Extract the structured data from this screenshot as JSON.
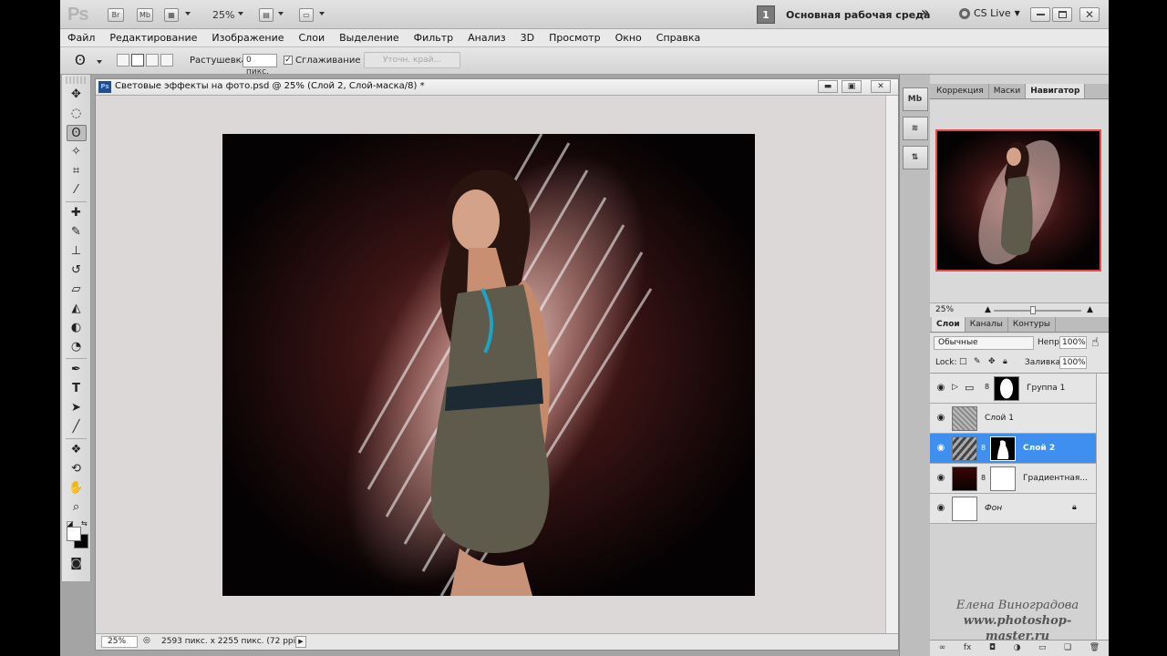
{
  "app": {
    "logo": "Ps",
    "zoom": "25%"
  },
  "appbar": {
    "buttons": [
      "Br",
      "Mb"
    ],
    "workspace_number": "1",
    "workspace_name": "Основная рабочая среда",
    "more_arrows": "»",
    "cs_live": "CS Live"
  },
  "menu": [
    "Файл",
    "Редактирование",
    "Изображение",
    "Слои",
    "Выделение",
    "Фильтр",
    "Анализ",
    "3D",
    "Просмотр",
    "Окно",
    "Справка"
  ],
  "options": {
    "feather_label": "Растушевка:",
    "feather_value": "0 пикс.",
    "antialias_label": "Сглаживание",
    "antialias_checked": "✓",
    "refine_edge": "Уточн. край..."
  },
  "document": {
    "ps_badge": "Ps",
    "title": "Световые эффекты на фото.psd @ 25% (Слой 2, Слой-маска/8) *",
    "status_zoom": "25%",
    "status_info": "2593 пикс. x 2255 пикс. (72 ppi)"
  },
  "panels": {
    "top_tabs": [
      "Коррекция",
      "Маски",
      "Навигатор"
    ],
    "navigator_zoom": "25%",
    "layer_tabs": [
      "Слои",
      "Каналы",
      "Контуры"
    ],
    "blend_mode": "Обычные",
    "opacity_label": "Непр:",
    "opacity_value": "100%",
    "lock_label": "Lock:",
    "fill_label": "Заливка:",
    "fill_value": "100%"
  },
  "layers": [
    {
      "name": "Группа 1"
    },
    {
      "name": "Слой 1"
    },
    {
      "name": "Слой 2"
    },
    {
      "name": "Градиентная..."
    },
    {
      "name": "Фон"
    }
  ],
  "dock": [
    "Mb",
    "≋",
    "⇅"
  ],
  "watermark": {
    "line1": "Елена Виноградова",
    "line2": "www.photoshop-master.ru"
  },
  "colors": {
    "accent_selected": "#3f8ff0",
    "navigator_frame": "#e34b4b"
  }
}
